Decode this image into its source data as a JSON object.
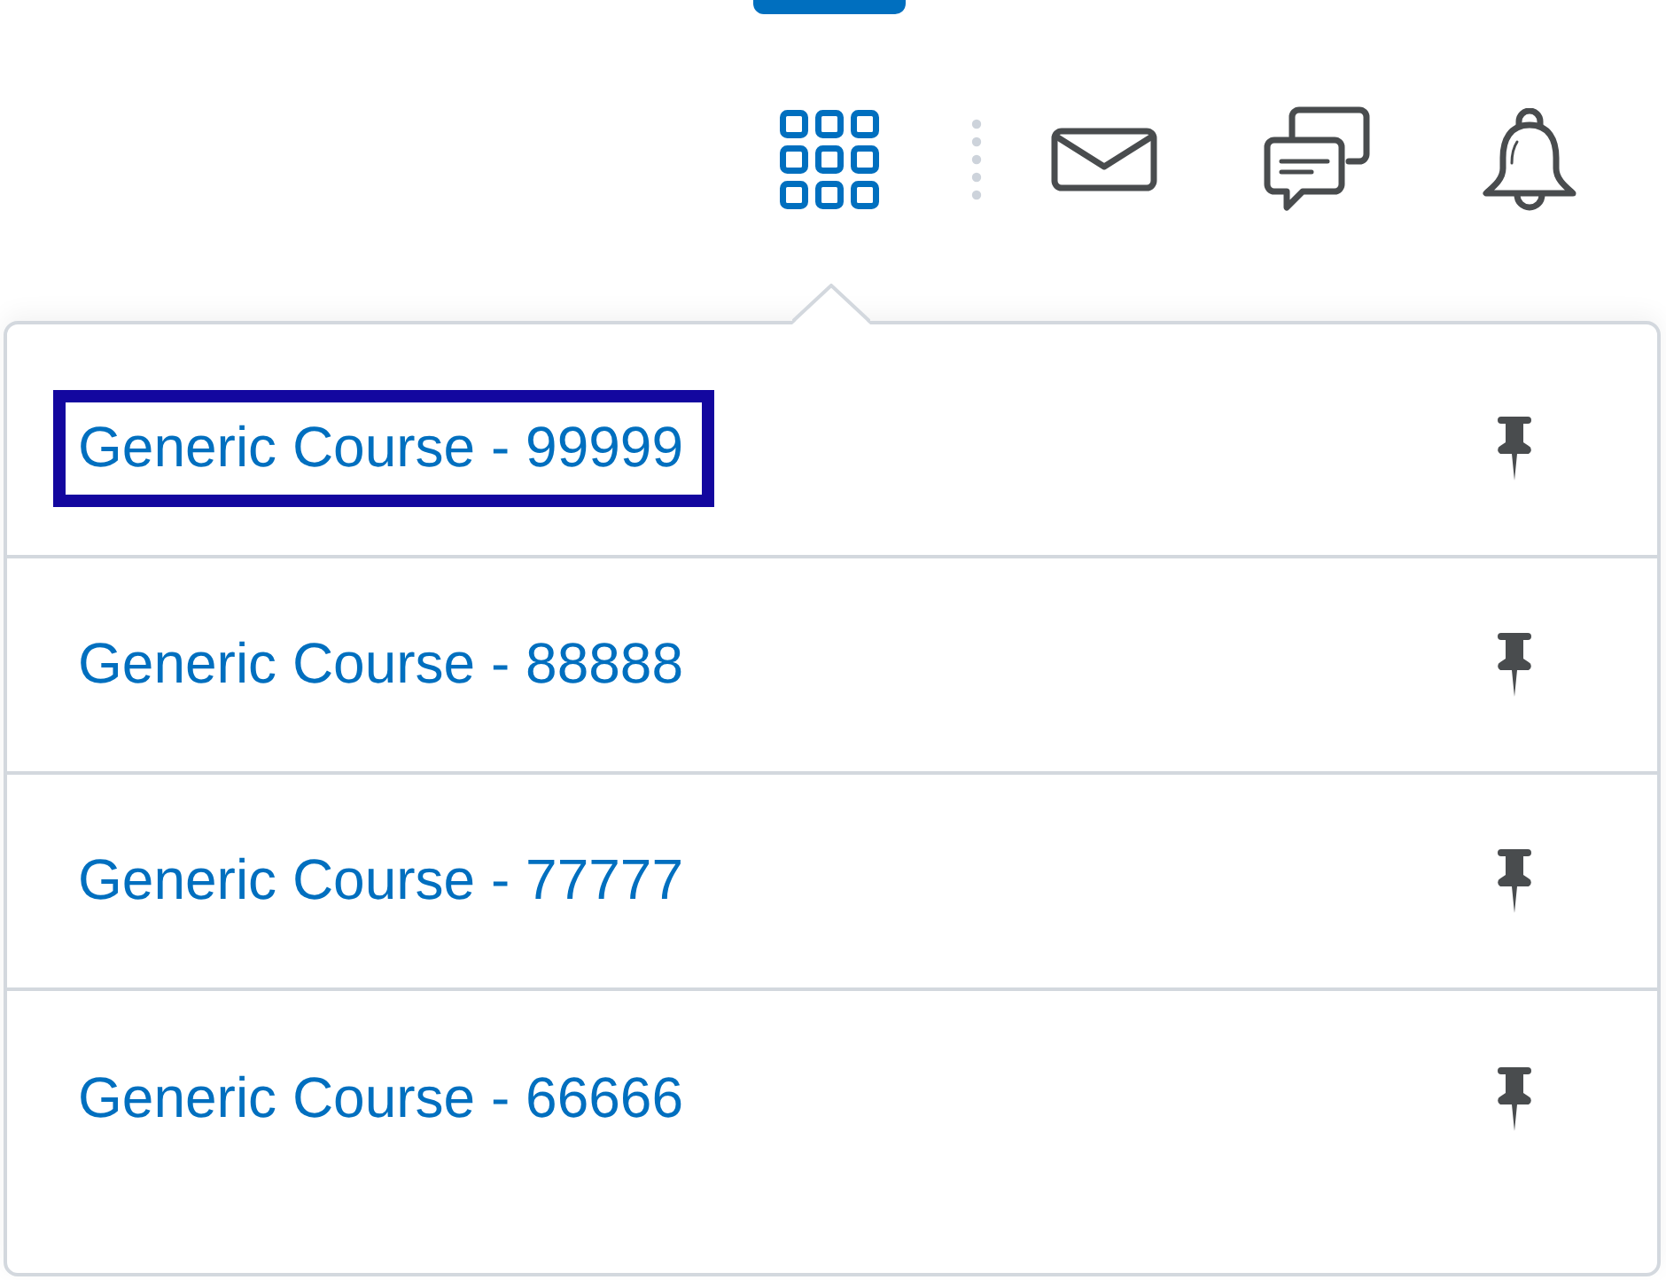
{
  "navbar": {
    "apps_button": {
      "open": true
    },
    "icons": [
      {
        "kind": "mail"
      },
      {
        "kind": "chat"
      },
      {
        "kind": "bell"
      }
    ]
  },
  "course_menu": {
    "items": [
      {
        "label": "Generic Course - 99999",
        "focused": true
      },
      {
        "label": "Generic Course - 88888",
        "focused": false
      },
      {
        "label": "Generic Course - 77777",
        "focused": false
      },
      {
        "label": "Generic Course - 66666",
        "focused": false
      }
    ]
  }
}
